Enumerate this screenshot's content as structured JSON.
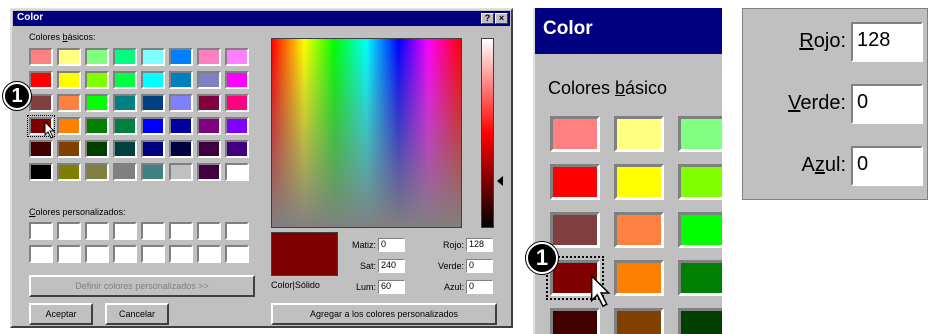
{
  "dialog": {
    "title": "Color",
    "help_button": "?",
    "close_button": "×",
    "basic_colors_label": {
      "before": "Colores ",
      "underlined": "b",
      "after": "ásicos:"
    },
    "basic_colors": [
      "#ff8080",
      "#ffff80",
      "#80ff80",
      "#00ff80",
      "#80ffff",
      "#0080ff",
      "#ff80c0",
      "#ff80ff",
      "#ff0000",
      "#ffff00",
      "#80ff00",
      "#00ff40",
      "#00ffff",
      "#0080c0",
      "#8080c0",
      "#ff00ff",
      "#804040",
      "#ff8040",
      "#00ff00",
      "#008080",
      "#004080",
      "#8080ff",
      "#800040",
      "#ff0080",
      "#800000",
      "#ff8000",
      "#008000",
      "#008040",
      "#0000ff",
      "#0000a0",
      "#800080",
      "#8000ff",
      "#400000",
      "#804000",
      "#004000",
      "#004040",
      "#000080",
      "#000040",
      "#400040",
      "#400080",
      "#000000",
      "#808000",
      "#808040",
      "#808080",
      "#408080",
      "#c0c0c0",
      "#400040",
      "#ffffff"
    ],
    "selected_basic_index": 24,
    "custom_colors_label": {
      "underlined": "C",
      "after": "olores personalizados:"
    },
    "define_custom_button": "Definir colores personalizados >>",
    "ok_button": "Aceptar",
    "cancel_button": "Cancelar",
    "add_custom_button": "Agregar a los colores personalizados",
    "color_solid_label": "Color|Sólido",
    "fields": {
      "hue": {
        "label": "Matiz:",
        "value": "0"
      },
      "sat": {
        "label": "Sat:",
        "value": "240"
      },
      "lum": {
        "label": "Lum:",
        "value": "60"
      },
      "red": {
        "label": "Rojo:",
        "value": "128"
      },
      "green": {
        "label": "Verde:",
        "value": "0"
      },
      "blue": {
        "label": "Azul:",
        "value": "0"
      }
    },
    "current_color": "#800000",
    "luminance_level": 0.25
  },
  "zoom_basic": {
    "title": "Color",
    "caption": {
      "before": "Colores ",
      "underlined": "b",
      "after": "ásico"
    },
    "colors": [
      "#ff8080",
      "#ffff80",
      "#80ff80",
      "#ff0000",
      "#ffff00",
      "#80ff00",
      "#804040",
      "#ff8040",
      "#00ff00",
      "#800000",
      "#ff8000",
      "#008000",
      "#400000",
      "#804000",
      "#004000"
    ],
    "selected_index": 9
  },
  "zoom_rgb": {
    "red": {
      "underlined": "R",
      "after": "ojo:",
      "value": "128"
    },
    "green": {
      "underlined": "V",
      "after": "erde:",
      "value": "0"
    },
    "blue": {
      "before": "A",
      "underlined": "z",
      "after": "ul:",
      "value": "0"
    }
  },
  "callouts": {
    "marker_1": "1",
    "marker_2": "1"
  }
}
